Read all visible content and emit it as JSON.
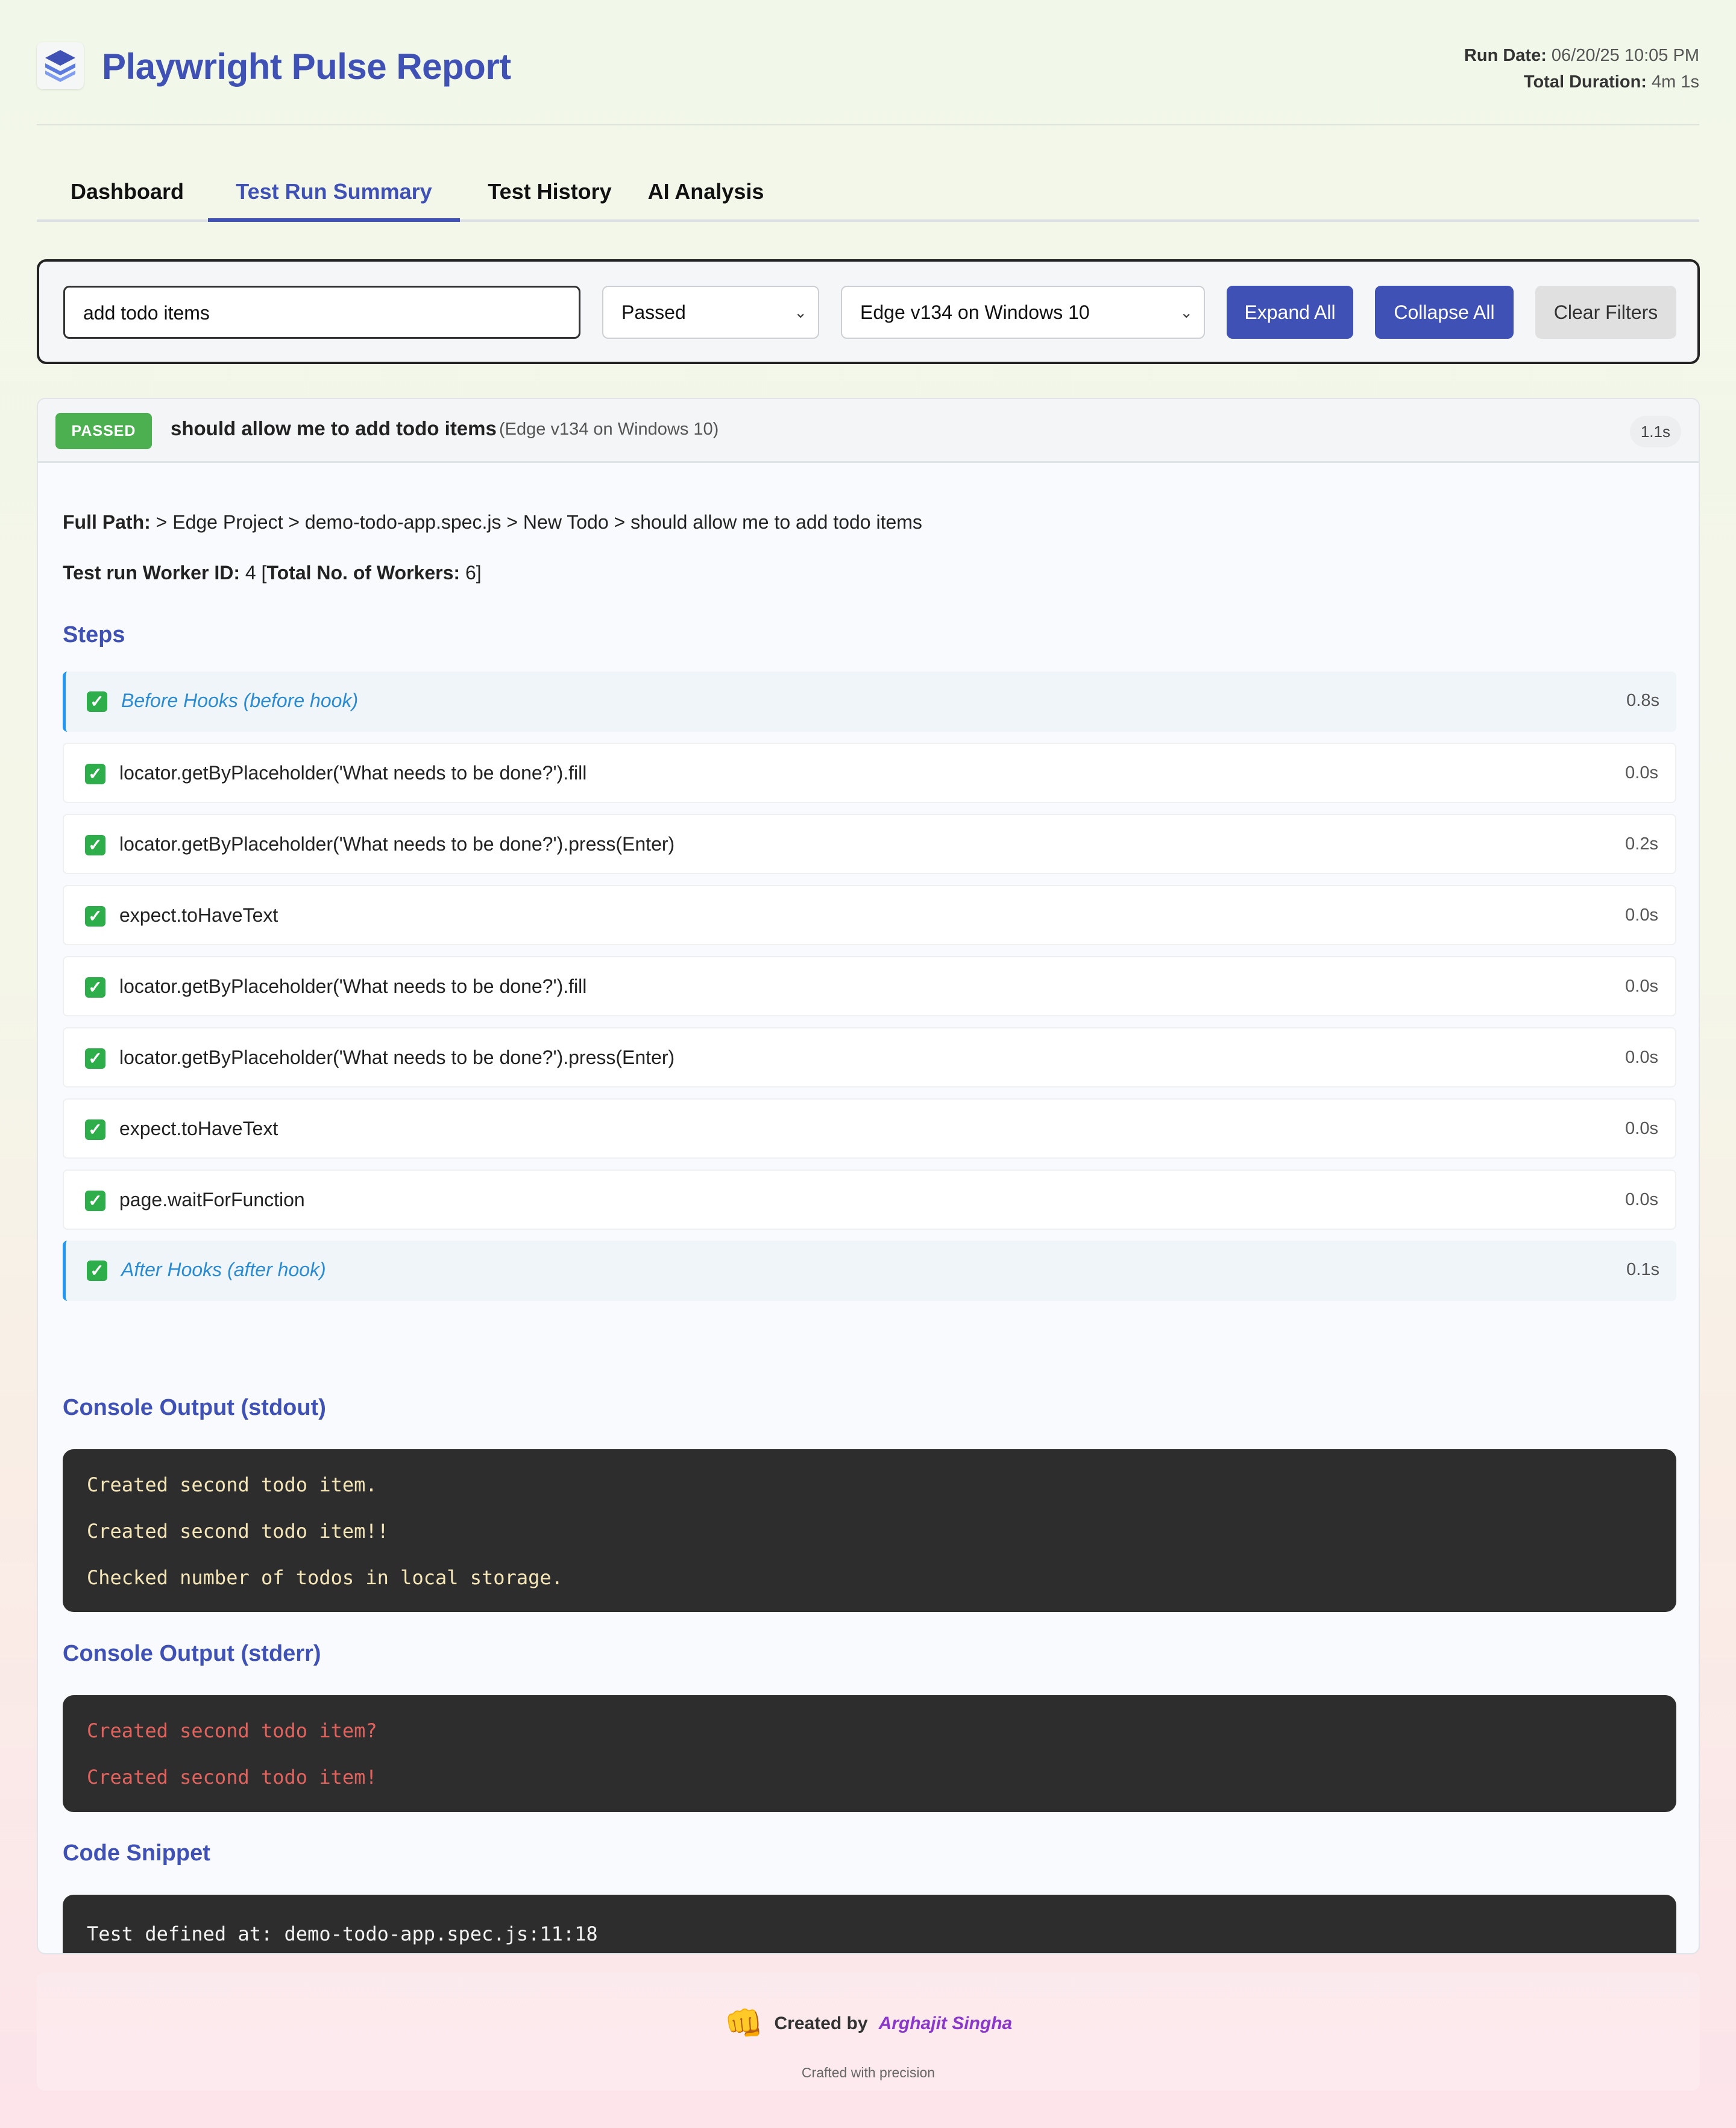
{
  "header": {
    "title": "Playwright Pulse Report",
    "run_date_label": "Run Date:",
    "run_date": "06/20/25 10:05 PM",
    "total_duration_label": "Total Duration:",
    "total_duration": "4m 1s"
  },
  "tabs": [
    {
      "label": "Dashboard"
    },
    {
      "label": "Test Run Summary"
    },
    {
      "label": "Test History"
    },
    {
      "label": "AI Analysis"
    }
  ],
  "filters": {
    "search_value": "add todo items",
    "status_selected": "Passed",
    "browser_selected": "Edge v134 on Windows 10",
    "expand_all": "Expand All",
    "collapse_all": "Collapse All",
    "clear_filters": "Clear Filters"
  },
  "test": {
    "status": "PASSED",
    "title": "should allow me to add todo items",
    "browser": "(Edge v134 on Windows 10)",
    "duration": "1.1s",
    "full_path_label": "Full Path:",
    "full_path": "> Edge Project > demo-todo-app.spec.js > New Todo > should allow me to add todo items",
    "worker_label": "Test run Worker ID:",
    "worker_id": "4",
    "total_workers_label": "Total No. of Workers:",
    "total_workers": "6",
    "steps_title": "Steps",
    "steps": [
      {
        "label": "Before Hooks (before hook)",
        "time": "0.8s",
        "hook": true
      },
      {
        "label": "locator.getByPlaceholder('What needs to be done?').fill",
        "time": "0.0s",
        "hook": false
      },
      {
        "label": "locator.getByPlaceholder('What needs to be done?').press(Enter)",
        "time": "0.2s",
        "hook": false
      },
      {
        "label": "expect.toHaveText",
        "time": "0.0s",
        "hook": false
      },
      {
        "label": "locator.getByPlaceholder('What needs to be done?').fill",
        "time": "0.0s",
        "hook": false
      },
      {
        "label": "locator.getByPlaceholder('What needs to be done?').press(Enter)",
        "time": "0.0s",
        "hook": false
      },
      {
        "label": "expect.toHaveText",
        "time": "0.0s",
        "hook": false
      },
      {
        "label": "page.waitForFunction",
        "time": "0.0s",
        "hook": false
      },
      {
        "label": "After Hooks (after hook)",
        "time": "0.1s",
        "hook": true
      }
    ],
    "stdout_title": "Console Output (stdout)",
    "stdout": [
      "Created second todo item.",
      "Created second todo item!!",
      "Checked number of todos in local storage."
    ],
    "stderr_title": "Console Output (stderr)",
    "stderr": [
      "Created second todo item?",
      "Created second todo item!"
    ],
    "code_title": "Code Snippet",
    "code": "Test defined at: demo-todo-app.spec.js:11:18"
  },
  "footer": {
    "created_by": "Created by",
    "author": "Arghajit Singha",
    "tagline": "Crafted with precision"
  },
  "colors": {
    "accent": "#3f51b5",
    "passed": "#4caf50",
    "hook": "#2196f3",
    "author": "#8a38c9"
  },
  "icons": {
    "logo": "layers-icon",
    "step_status": "check-box-icon",
    "footer": "fist-emoji-icon"
  }
}
